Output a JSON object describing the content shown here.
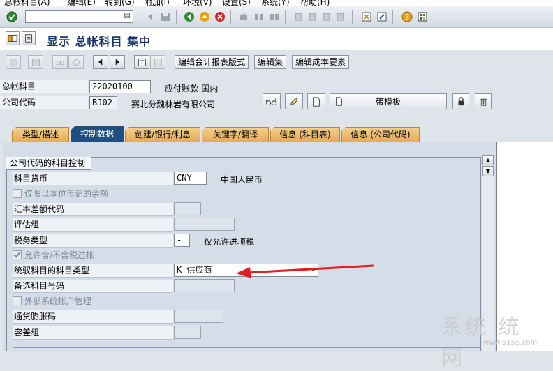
{
  "menu": [
    "总帐科目(A)",
    "编辑(E)",
    "转到(G)",
    "附加(I)",
    "环境(V)",
    "设置(S)",
    "系统(Y)",
    "帮助(H)"
  ],
  "title": "显示 总帐科目 集中",
  "app_toolbar": {
    "btn1": "编辑会计报表版式",
    "btn2": "编辑集",
    "btn3": "编辑成本要素"
  },
  "header": {
    "gl_account_label": "总帐科目",
    "gl_account_value": "22020100",
    "gl_account_desc": "应付账款-国内",
    "company_label": "公司代码",
    "company_value": "BJ02",
    "company_desc": "赛北分魏林岩有限公司",
    "template_button": "带模板"
  },
  "tabs": [
    "类型/描述",
    "控制数据",
    "创建/银行/利息",
    "关键字/翻译",
    "信息 (科目表)",
    "信息 (公司代码)"
  ],
  "group": {
    "title": "公司代码的科目控制",
    "currency_label": "科目货币",
    "currency_value": "CNY",
    "currency_desc": "中国人民币",
    "local_only_label": "仅限以本位币记的余额",
    "exch_diff_label": "汇率差额代码",
    "valuation_label": "评估组",
    "tax_cat_label": "税务类型",
    "tax_cat_value": "-",
    "tax_cat_desc": "仅允许进项税",
    "post_wo_tax_label": "允许含/不含税过帐",
    "recon_label": "统驭科目的科目类型",
    "recon_value": "K 供应商",
    "alt_acct_label": "备选科目号码",
    "ext_mgmt_label": "外部系统帐户管理",
    "inflation_label": "通货膨胀码",
    "tolerance_label": "容差组"
  },
  "watermark": {
    "text": "系统 统 网",
    "url": "www.51sis.com"
  },
  "colors": {
    "active_tab": "#1f4f80",
    "tab": "#e3ad55",
    "arrow": "#e02020",
    "title": "#18346a"
  }
}
